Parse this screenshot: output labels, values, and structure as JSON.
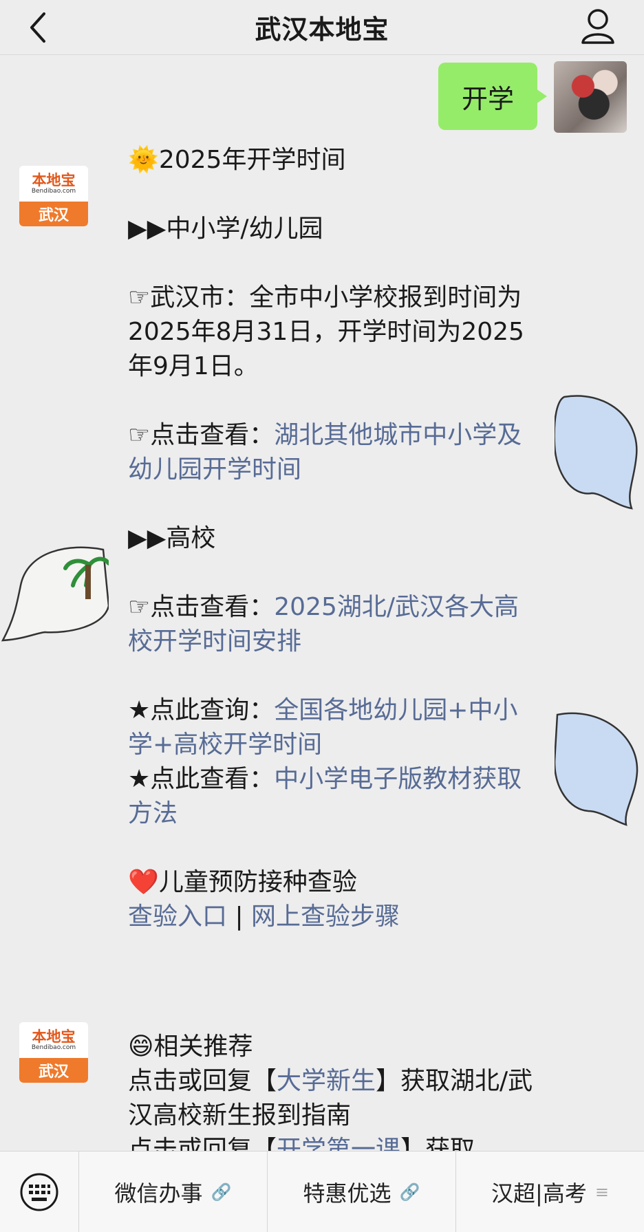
{
  "header": {
    "title": "武汉本地宝"
  },
  "outgoing": {
    "text": "开学"
  },
  "account": {
    "brand": "本地宝",
    "domain": "Bendibao.com",
    "city": "武汉"
  },
  "message": {
    "line1": "🌞2025年开学时间",
    "section1": "▶▶中小学/幼儿园",
    "p1": "☞武汉市：全市中小学校报到时间为2025年8月31日，开学时间为2025年9月1日。",
    "p2_prefix": "☞点击查看：",
    "p2_link": "湖北其他城市中小学及幼儿园开学时间",
    "section2": "▶▶高校",
    "p3_prefix": "☞点击查看：",
    "p3_link": "2025湖北/武汉各大高校开学时间安排",
    "p4_prefix": "★点此查询：",
    "p4_link": "全国各地幼儿园+中小学+高校开学时间",
    "p5_prefix": "★点此查看：",
    "p5_link": "中小学电子版教材获取方法",
    "p6_title": "❤️儿童预防接种查验",
    "p6_link1": "查验入口",
    "p6_sep": " | ",
    "p6_link2": "网上查验步骤"
  },
  "message2": {
    "title": "😄相关推荐",
    "l1_prefix": "点击或回复【",
    "l1_link": "大学新生",
    "l1_suffix": "】获取湖北/武汉高校新生报到指南",
    "l2_prefix": "点击或回复【",
    "l2_link": "开学第一课",
    "l2_suffix": "】获取"
  },
  "menu": {
    "items": [
      {
        "label": "微信办事",
        "icon": "link-icon"
      },
      {
        "label": "特惠优选",
        "icon": "link-icon"
      },
      {
        "label": "汉超|高考",
        "icon": "list-icon"
      }
    ]
  }
}
